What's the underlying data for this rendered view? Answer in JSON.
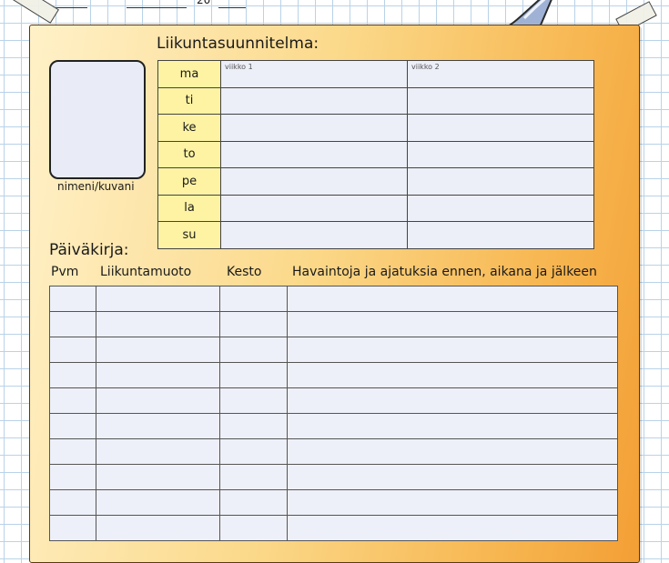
{
  "title": "Liikuntasuunnitelma:",
  "photo_label": "nimeni/kuvani",
  "top_fragment": "20",
  "plan": {
    "days": [
      "ma",
      "ti",
      "ke",
      "to",
      "pe",
      "la",
      "su"
    ],
    "week1": "viikko 1",
    "week2": "viikko 2"
  },
  "diary": {
    "title": "Päiväkirja:",
    "columns": [
      "Pvm",
      "Liikuntamuoto",
      "Kesto",
      "Havaintoja ja ajatuksia ennen, aikana ja jälkeen"
    ],
    "visible_rows": 10
  }
}
